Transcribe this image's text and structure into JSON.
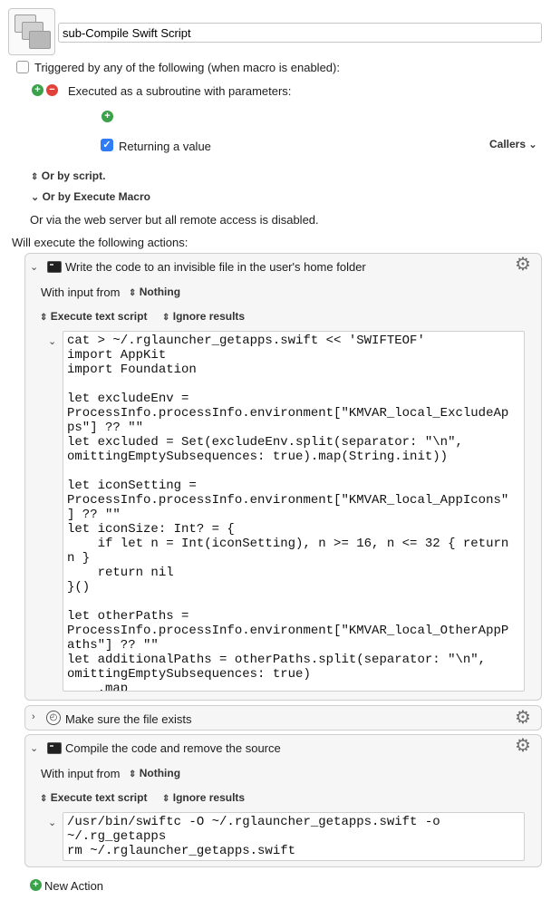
{
  "header": {
    "macro_name": "sub-Compile Swift Script"
  },
  "triggers": {
    "triggered_label": "Triggered by any of the following (when macro is enabled):",
    "subroutine_label": "Executed as a subroutine with parameters:",
    "returning_label": "Returning a value",
    "callers_label": "Callers",
    "or_by_script": "Or by script.",
    "or_by_execute_macro": "Or by Execute Macro",
    "web_server_note": "Or via the web server but all remote access is disabled.",
    "will_execute": "Will execute the following actions:"
  },
  "actions": [
    {
      "title": "Write the code to an invisible file in the user's home folder",
      "with_input_label": "With input from",
      "with_input_value": "Nothing",
      "execute_label": "Execute text script",
      "results_label": "Ignore results",
      "code": "cat > ~/.rglauncher_getapps.swift << 'SWIFTEOF'\nimport AppKit\nimport Foundation\n\nlet excludeEnv =\nProcessInfo.processInfo.environment[\"KMVAR_local_ExcludeAp\nps\"] ?? \"\"\nlet excluded = Set(excludeEnv.split(separator: \"\\n\",\nomittingEmptySubsequences: true).map(String.init))\n\nlet iconSetting =\nProcessInfo.processInfo.environment[\"KMVAR_local_AppIcons\"\n] ?? \"\"\nlet iconSize: Int? = {\n    if let n = Int(iconSetting), n >= 16, n <= 32 { return\nn }\n    return nil\n}()\n\nlet otherPaths =\nProcessInfo.processInfo.environment[\"KMVAR_local_OtherAppP\naths\"] ?? \"\"\nlet additionalPaths = otherPaths.split(separator: \"\\n\",\nomittingEmptySubsequences: true)\n    .map"
    },
    {
      "title": "Make sure the file exists"
    },
    {
      "title": "Compile the code and remove the source",
      "with_input_label": "With input from",
      "with_input_value": "Nothing",
      "execute_label": "Execute text script",
      "results_label": "Ignore results",
      "code": "/usr/bin/swiftc -O ~/.rglauncher_getapps.swift -o\n~/.rg_getapps\nrm ~/.rglauncher_getapps.swift"
    }
  ],
  "footer": {
    "new_action_label": "New Action"
  },
  "icons": {
    "gear": "gear-icon",
    "terminal": "terminal-icon",
    "clock": "clock-icon"
  }
}
